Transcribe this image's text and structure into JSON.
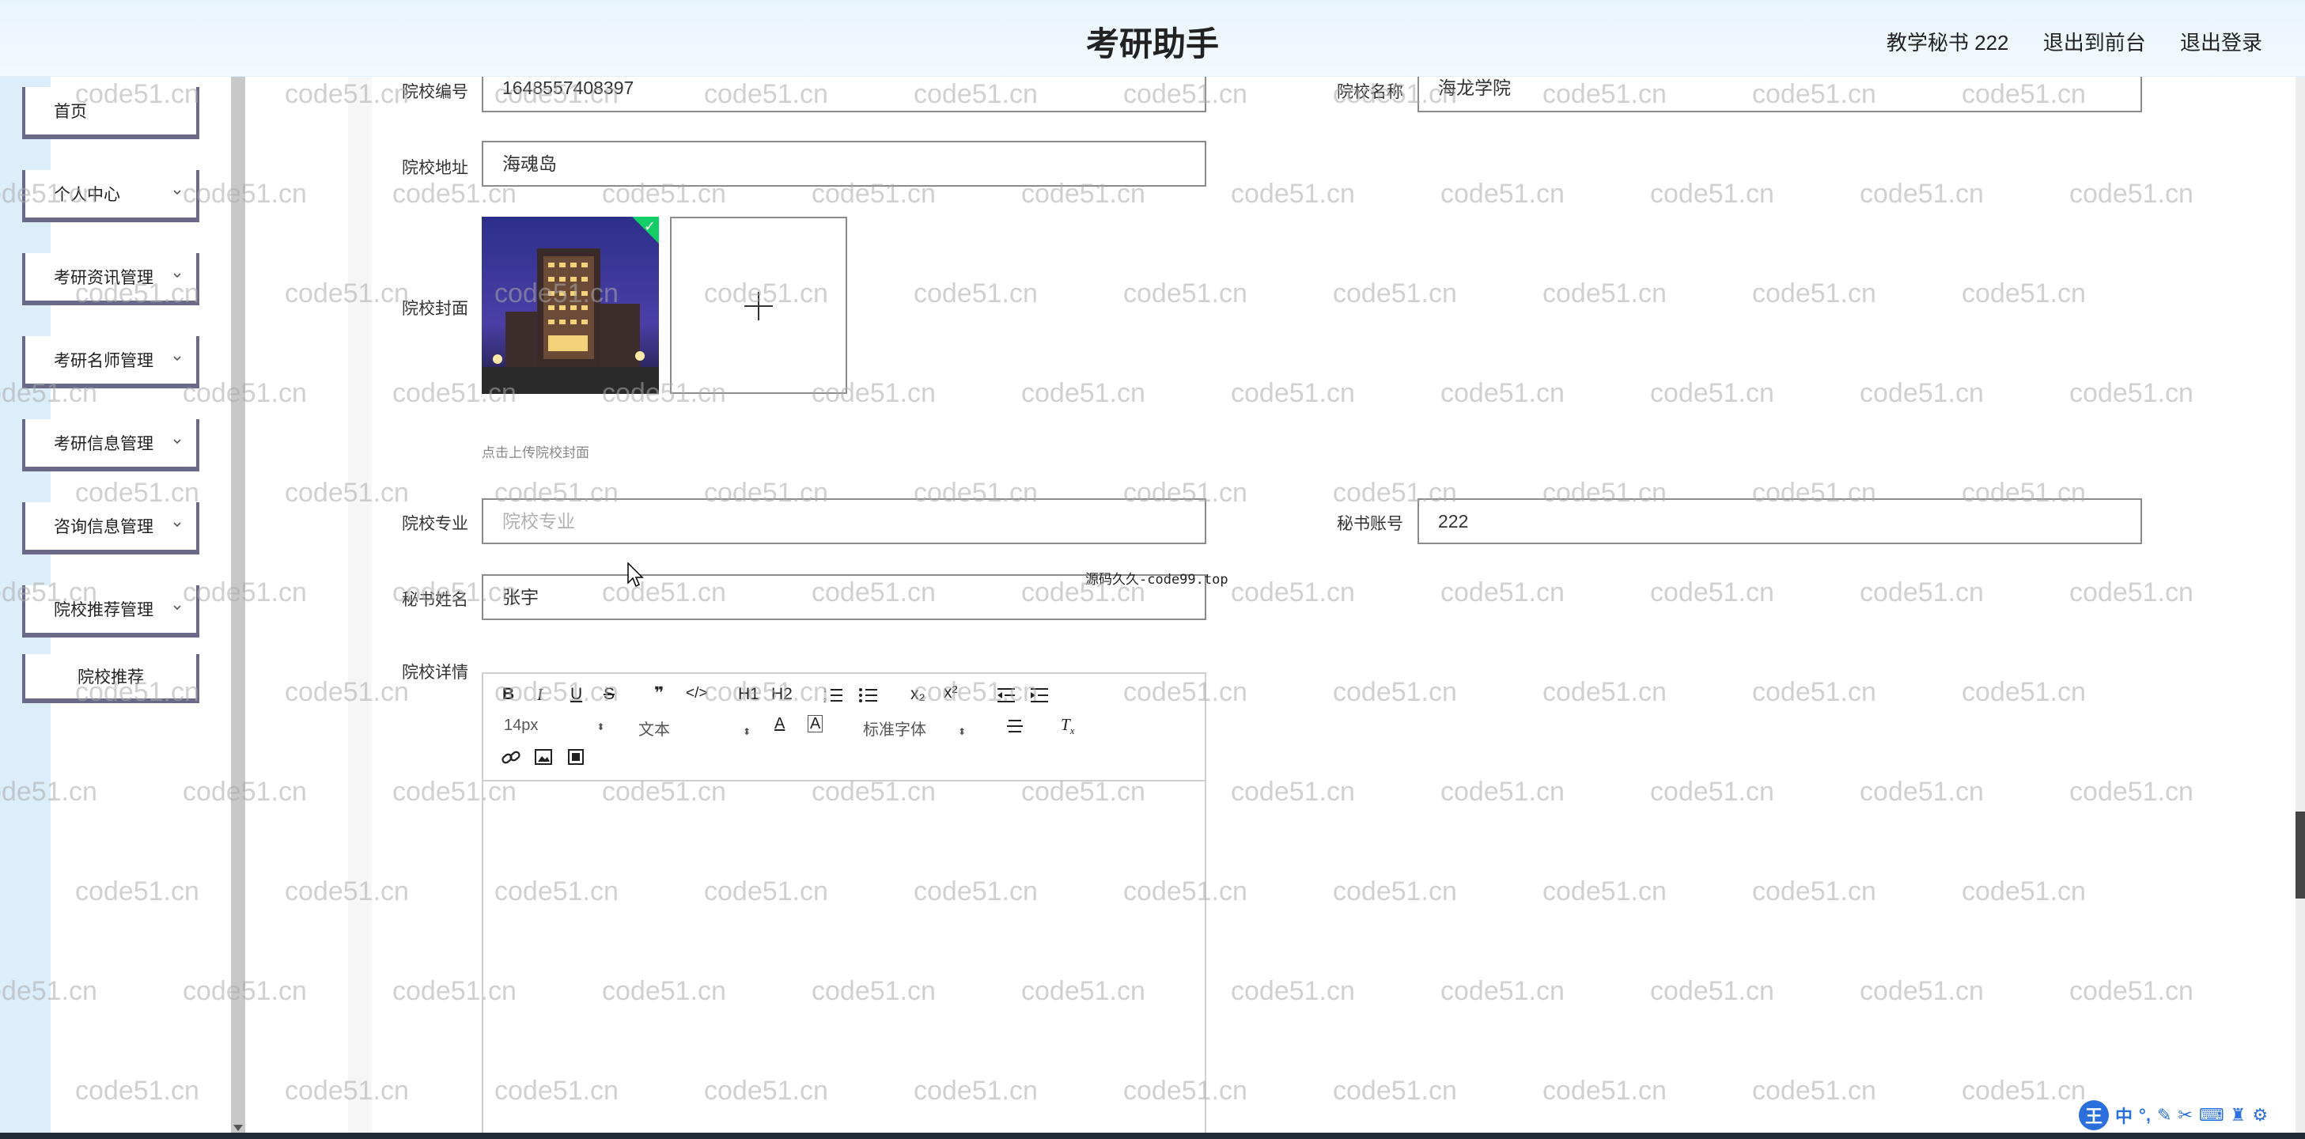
{
  "header": {
    "title": "考研助手",
    "user_label": "教学秘书 222",
    "front_label": "退出到前台",
    "logout_label": "退出登录"
  },
  "sidebar": {
    "items": [
      {
        "label": "首页",
        "has_arrow": false
      },
      {
        "label": "个人中心",
        "has_arrow": true
      },
      {
        "label": "考研资讯管理",
        "has_arrow": true
      },
      {
        "label": "考研名师管理",
        "has_arrow": true
      },
      {
        "label": "考研信息管理",
        "has_arrow": true
      },
      {
        "label": "咨询信息管理",
        "has_arrow": true
      },
      {
        "label": "院校推荐管理",
        "has_arrow": true
      }
    ],
    "sub_item": "院校推荐"
  },
  "form": {
    "school_no_label": "院校编号",
    "school_no_value": "1648557408397",
    "school_name_label": "院校名称",
    "school_name_value": "海龙学院",
    "address_label": "院校地址",
    "address_value": "海魂岛",
    "cover_label": "院校封面",
    "cover_hint": "点击上传院校封面",
    "major_label": "院校专业",
    "major_placeholder": "院校专业",
    "secretary_account_label": "秘书账号",
    "secretary_account_value": "222",
    "secretary_name_label": "秘书姓名",
    "secretary_name_value": "张宇",
    "detail_label": "院校详情"
  },
  "floating_note": "源码久久-code99.top",
  "editor": {
    "font_size": "14px",
    "paragraph": "文本",
    "font_family": "标准字体",
    "buttons": [
      "B",
      "I",
      "U",
      "S",
      "❞",
      "</>",
      "H1",
      "H2",
      "ol",
      "ul",
      "x₂",
      "x²",
      "outdent",
      "indent",
      "A",
      "A-bg",
      "align",
      "Tx",
      "link",
      "image",
      "video"
    ]
  },
  "watermark": "code51.cn",
  "ime": {
    "logo": "王",
    "mode": "中"
  },
  "colors": {
    "accent": "#2a6fdb",
    "success": "#13ce66",
    "menu_border": "#6a6a88"
  }
}
